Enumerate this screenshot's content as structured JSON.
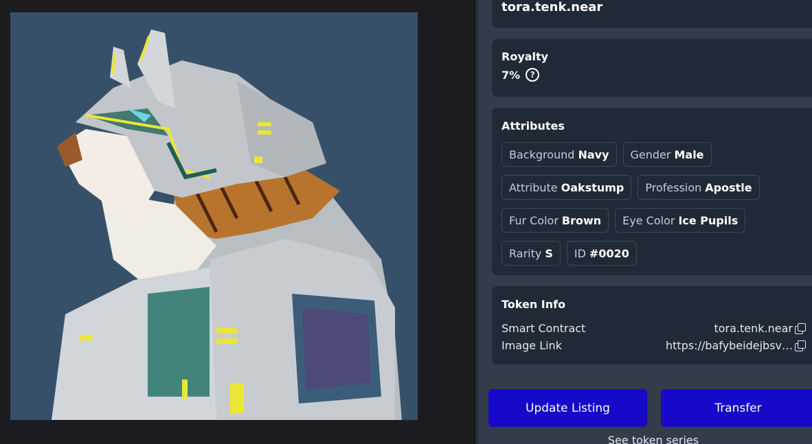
{
  "owner": {
    "name": "tora.tenk.near"
  },
  "royalty": {
    "title": "Royalty",
    "value": "7%",
    "help_icon": "question-circle-icon"
  },
  "attributes": {
    "title": "Attributes",
    "items": [
      {
        "key": "Background",
        "value": "Navy"
      },
      {
        "key": "Gender",
        "value": "Male"
      },
      {
        "key": "Attribute",
        "value": "Oakstump"
      },
      {
        "key": "Profession",
        "value": "Apostle"
      },
      {
        "key": "Fur Color",
        "value": "Brown"
      },
      {
        "key": "Eye Color",
        "value": "Ice Pupils"
      },
      {
        "key": "Rarity",
        "value": "S"
      },
      {
        "key": "ID",
        "value": "#0020"
      }
    ]
  },
  "token_info": {
    "title": "Token Info",
    "smart_contract_label": "Smart Contract",
    "smart_contract_value": "tora.tenk.near",
    "image_link_label": "Image Link",
    "image_link_value": "https://bafybeidejbsv…",
    "copy_icon": "copy-icon"
  },
  "actions": {
    "update_listing": "Update Listing",
    "transfer": "Transfer",
    "see_series": "See token series"
  },
  "colors": {
    "primary_button": "#1609c9",
    "card_bg": "#202a36",
    "panel_bg": "#323c4b",
    "art_bg": "#37506a"
  }
}
